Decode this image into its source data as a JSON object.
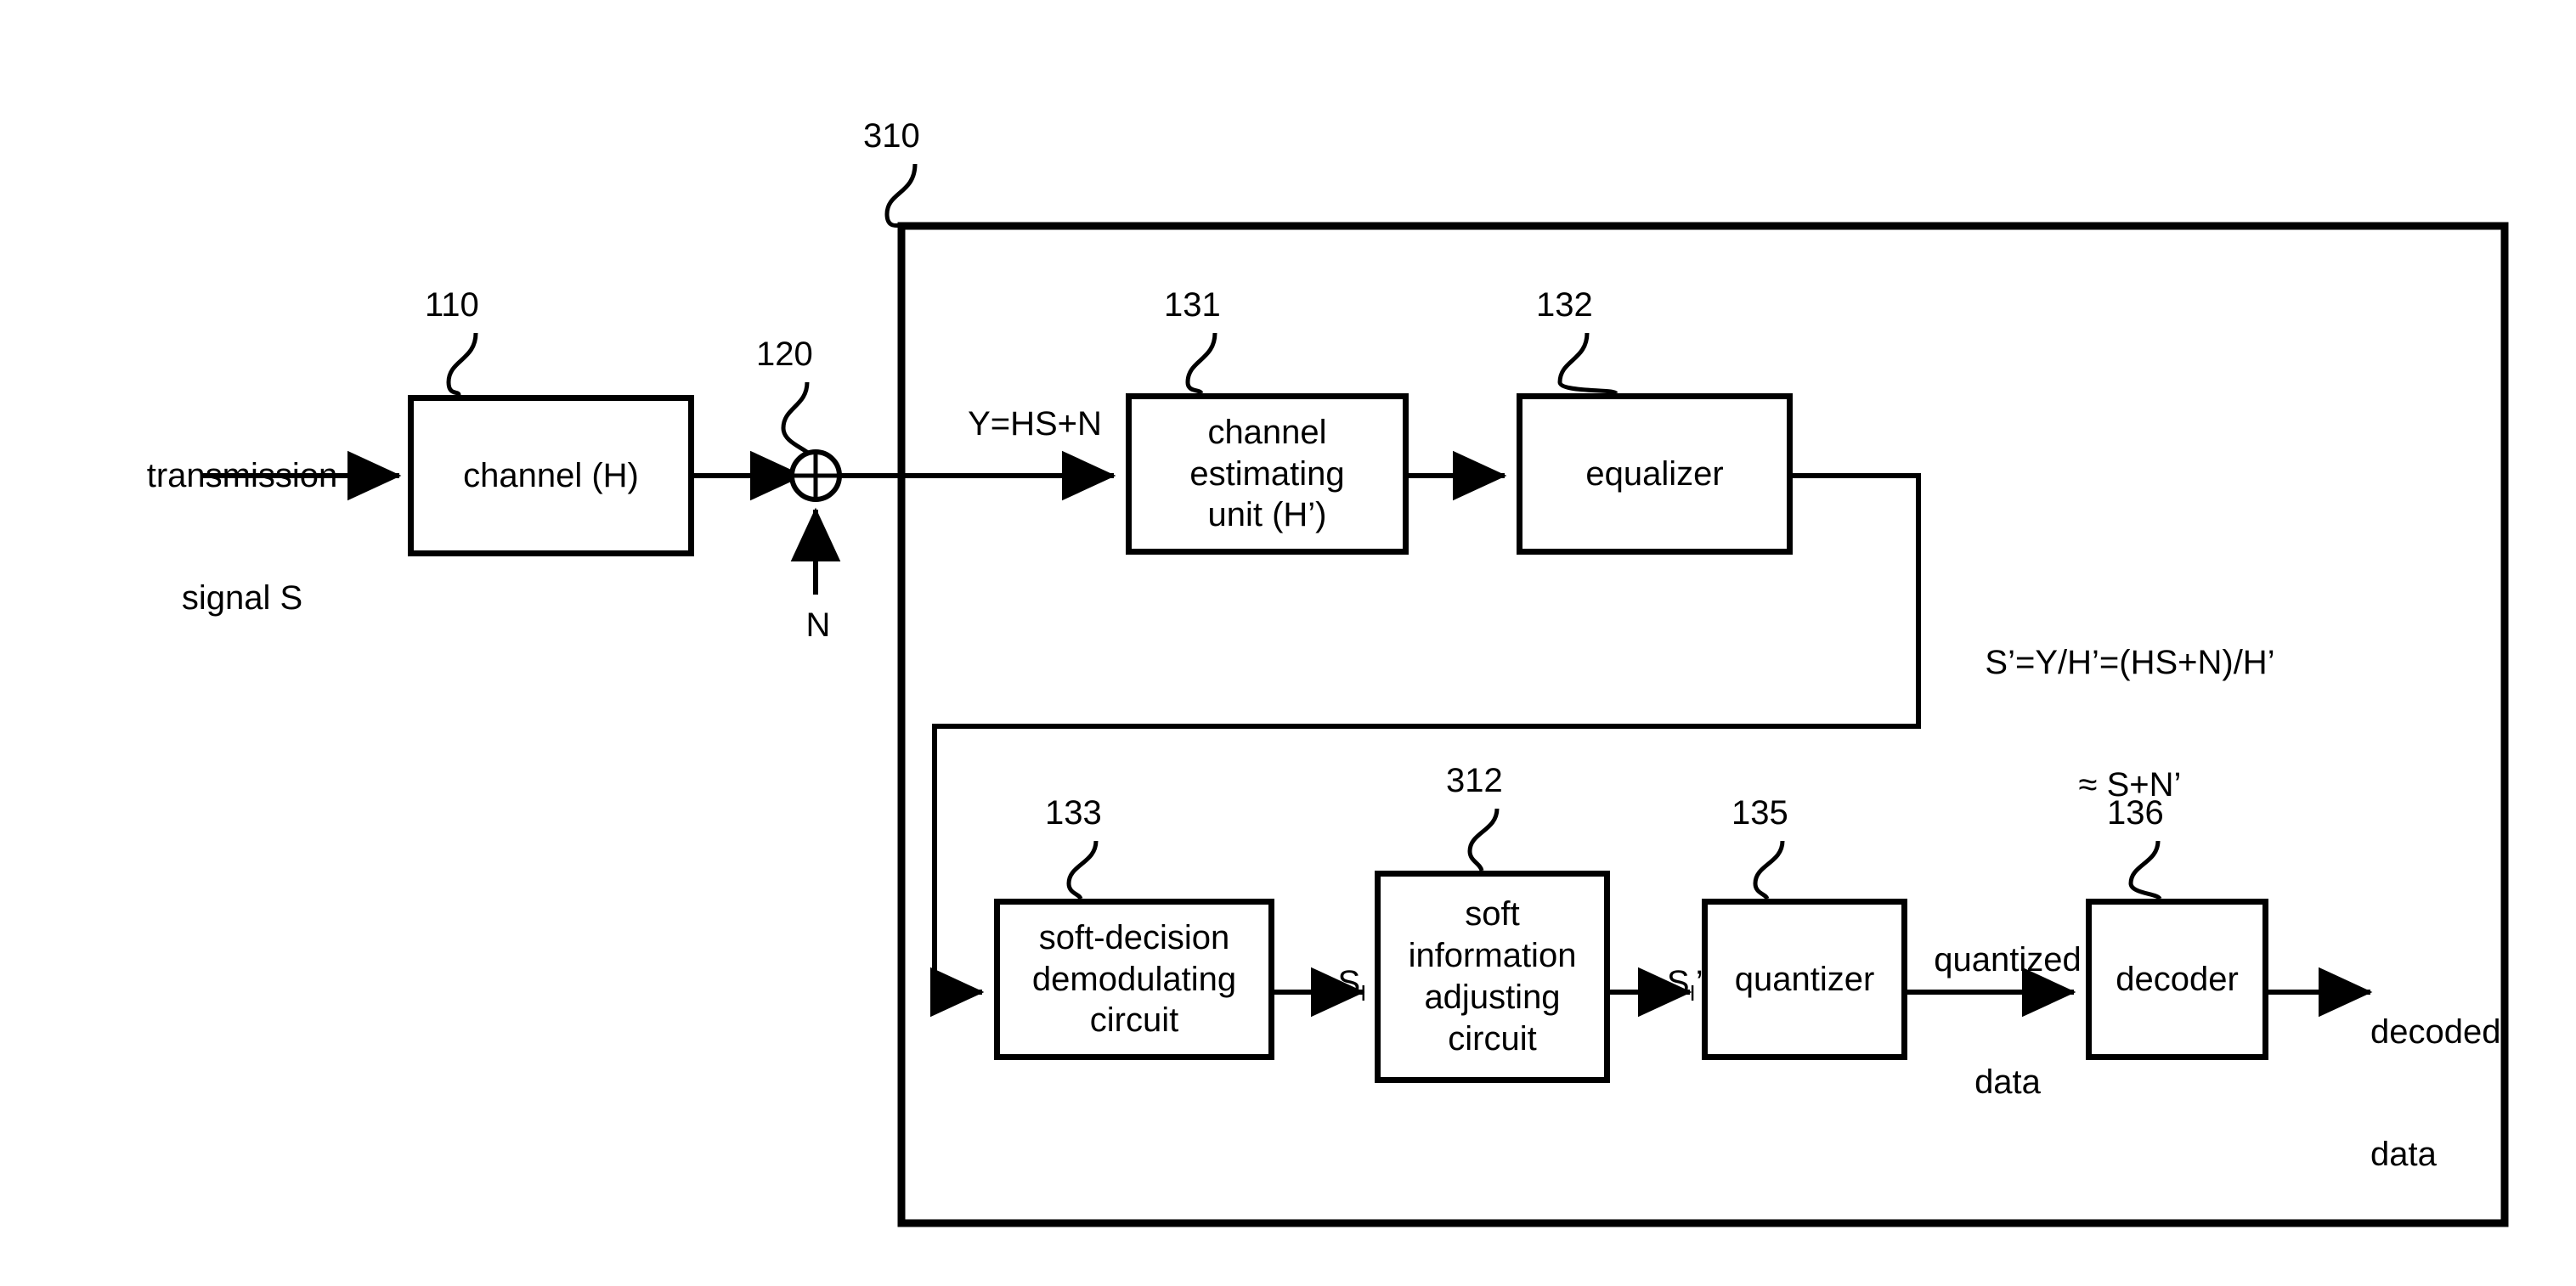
{
  "figure": {
    "type": "block-diagram",
    "domain": "patent-figure",
    "description": "Receiver block diagram with channel, noise summation, channel estimating unit, equalizer, soft-decision demodulating circuit, soft information adjusting circuit, quantizer and decoder"
  },
  "outer_box": {
    "ref": "310"
  },
  "blocks": [
    {
      "ref": "110",
      "label": "channel (H)",
      "lines": [
        "channel (H)"
      ]
    },
    {
      "ref": "131",
      "label": "channel estimating unit (H')",
      "lines": [
        "channel",
        "estimating",
        "unit (H’)"
      ]
    },
    {
      "ref": "132",
      "label": "equalizer",
      "lines": [
        "equalizer"
      ]
    },
    {
      "ref": "133",
      "label": "soft-decision demodulating circuit",
      "lines": [
        "soft-decision",
        "demodulating",
        "circuit"
      ]
    },
    {
      "ref": "312",
      "label": "soft information adjusting circuit",
      "lines": [
        "soft",
        "information",
        "adjusting",
        "circuit"
      ]
    },
    {
      "ref": "135",
      "label": "quantizer",
      "lines": [
        "quantizer"
      ]
    },
    {
      "ref": "136",
      "label": "decoder",
      "lines": [
        "decoder"
      ]
    }
  ],
  "adder": {
    "ref": "120",
    "symbol": "plus-circle"
  },
  "signals": {
    "input": "transmission\nsignal S",
    "input_line1": "transmission",
    "input_line2": "signal S",
    "noise": "N",
    "y": "Y=HS+N",
    "s_prime_line1": "S’=Y/H’=(HS+N)/H’",
    "s_prime_line2": "≈ S+N’",
    "s_i_base": "S",
    "s_i_sub": "I",
    "s_i_prime_base": "S",
    "s_i_prime_sub": "I",
    "s_i_prime_tail": "’",
    "quantized_line1": "quantized",
    "quantized_line2": "data",
    "decoded_line1": "decoded",
    "decoded_line2": "data"
  },
  "colors": {
    "stroke": "#000000",
    "background": "#ffffff"
  }
}
